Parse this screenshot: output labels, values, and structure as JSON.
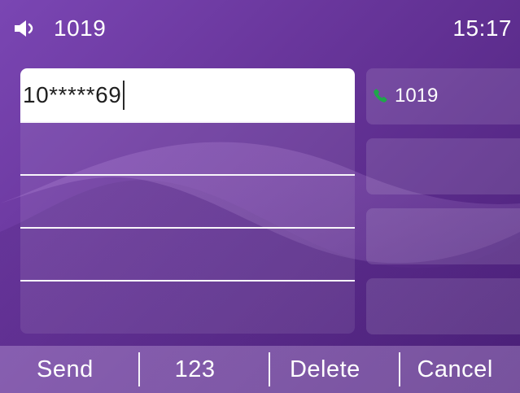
{
  "status_bar": {
    "account_number": "1019",
    "time": "15:17",
    "speaker_icon": "speaker-icon"
  },
  "dialer": {
    "input_value": "10*****69",
    "rows": [
      "",
      "",
      "",
      ""
    ]
  },
  "line_keys": [
    {
      "label": "1019",
      "icon": "phone-handset-icon",
      "icon_color": "#1fa64a"
    },
    {
      "label": ""
    },
    {
      "label": ""
    },
    {
      "label": ""
    }
  ],
  "softkeys": [
    {
      "label": "Send"
    },
    {
      "label": "123"
    },
    {
      "label": "Delete"
    },
    {
      "label": "Cancel"
    }
  ],
  "colors": {
    "background_start": "#7a46b3",
    "background_end": "#4a1f78",
    "text": "#ffffff",
    "input_background": "#ffffff",
    "input_text": "#1f1f1f"
  }
}
